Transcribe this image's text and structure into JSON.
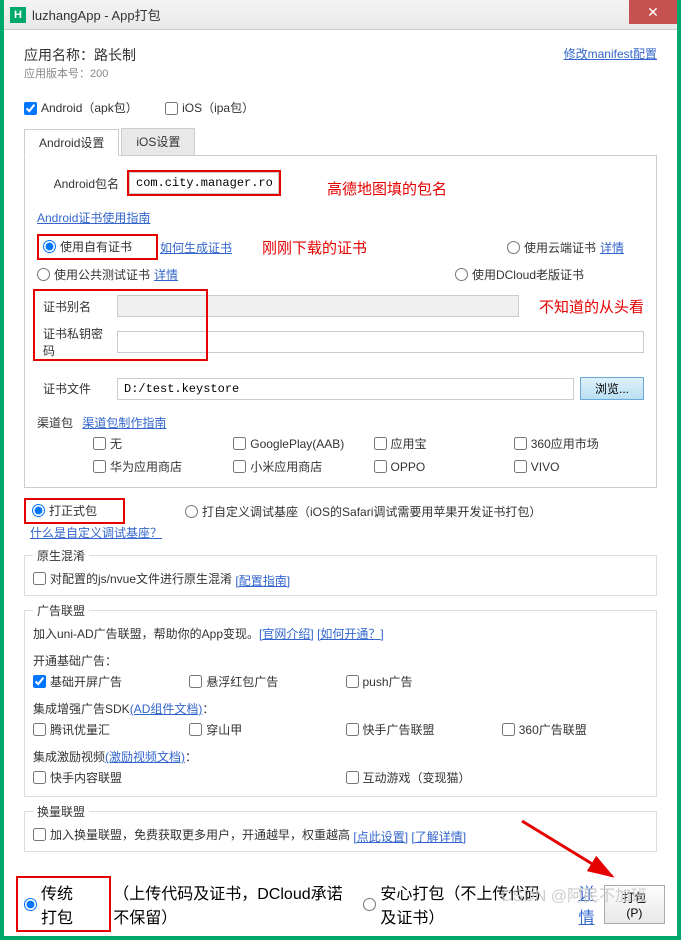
{
  "titlebar": {
    "icon": "H",
    "text": "luzhangApp - App打包"
  },
  "header": {
    "app_name_label": "应用名称：路长制",
    "version_label": "应用版本号：200",
    "manifest_link": "修改manifest配置"
  },
  "platform": {
    "android_label": "Android（apk包）",
    "ios_label": "iOS（ipa包）"
  },
  "tabs": {
    "android": "Android设置",
    "ios": "iOS设置"
  },
  "pkg": {
    "label": "Android包名",
    "value": "com.city.manager.road",
    "annotation": "高德地图填的包名"
  },
  "cert_guide_link": "Android证书使用指南",
  "cert_radios": {
    "own": "使用自有证书",
    "own_link": "如何生成证书",
    "cloud": "使用云端证书",
    "cloud_link": "详情",
    "public": "使用公共测试证书",
    "public_link": "详情",
    "dcloud": "使用DCloud老版证书",
    "annotation": "刚刚下载的证书"
  },
  "cert_fields": {
    "alias_label": "证书别名",
    "pwd_label": "证书私钥密码",
    "file_label": "证书文件",
    "file_value": "D:/test.keystore",
    "browse": "浏览...",
    "annotation": "不知道的从头看"
  },
  "channel": {
    "label": "渠道包",
    "guide_link": "渠道包制作指南",
    "items": [
      "无",
      "GooglePlay(AAB)",
      "应用宝",
      "360应用市场",
      "华为应用商店",
      "小米应用商店",
      "OPPO",
      "VIVO"
    ]
  },
  "pack_type": {
    "formal": "打正式包",
    "custom": "打自定义调试基座（iOS的Safari调试需要用苹果开发证书打包）",
    "what_link": "什么是自定义调试基座？"
  },
  "obfuscate": {
    "legend": "原生混淆",
    "label": "对配置的js/nvue文件进行原生混淆",
    "link": "[配置指南]"
  },
  "ads": {
    "legend": "广告联盟",
    "intro": "加入uni-AD广告联盟，帮助你的App变现。",
    "link1": "[官网介绍]",
    "link2": "[如何开通？]",
    "basic_title": "开通基础广告：",
    "basic_items": [
      "基础开屏广告",
      "悬浮红包广告",
      "push广告"
    ],
    "enhance_title": "集成增强广告SDK",
    "enhance_link": "(AD组件文档)",
    "enhance_items": [
      "腾讯优量汇",
      "穿山甲",
      "快手广告联盟",
      "360广告联盟"
    ],
    "incentive_title": "集成激励视频",
    "incentive_link": "(激励视频文档)",
    "incentive_items": [
      "快手内容联盟",
      "互动游戏（变现猫）"
    ]
  },
  "exchange": {
    "legend": "换量联盟",
    "label": "加入换量联盟，免费获取更多用户，开通越早，权重越高",
    "link1": "[点此设置]",
    "link2": "[了解详情]"
  },
  "bottom": {
    "traditional": "传统打包",
    "traditional_note": "（上传代码及证书，DCloud承诺不保留）",
    "safe": "安心打包（不上传代码及证书）",
    "safe_link": "详情",
    "pack_btn": "打包(P)"
  },
  "watermark": "CSDN @阿民不加班"
}
